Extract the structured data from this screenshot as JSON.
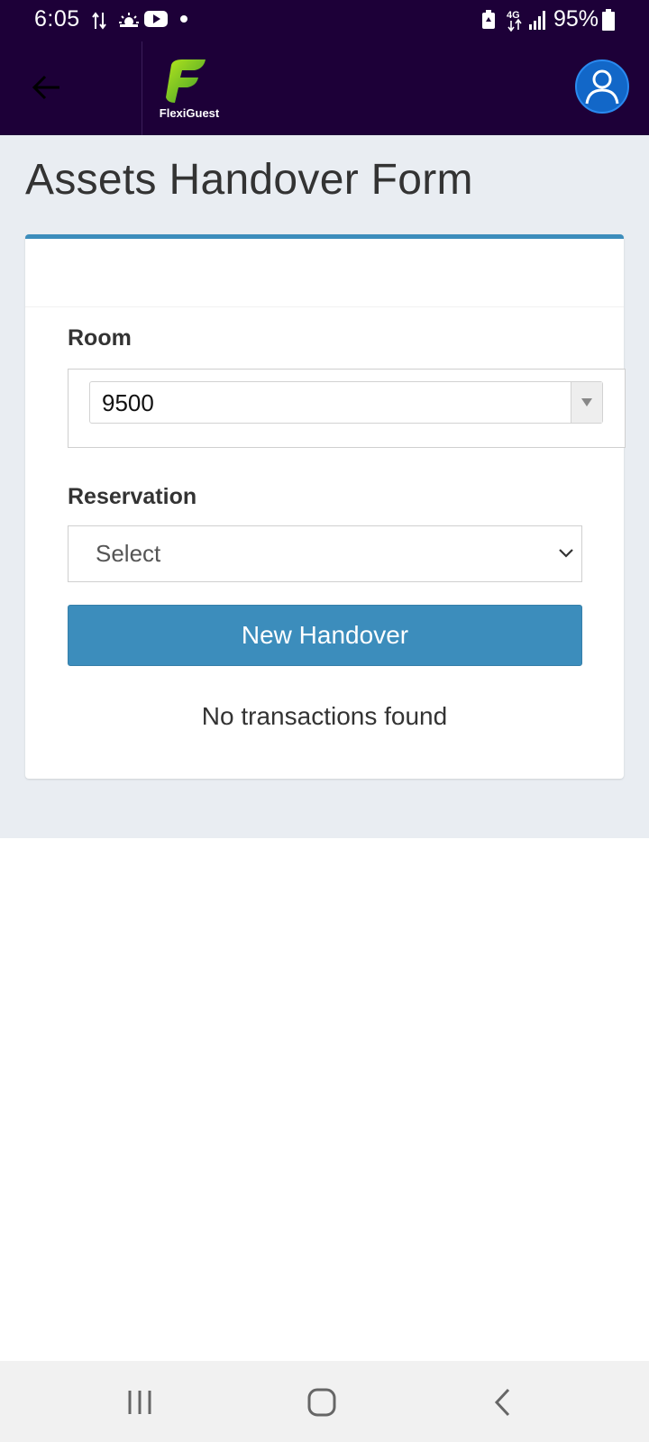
{
  "status_bar": {
    "time": "6:05",
    "battery_percent": "95%",
    "network_type": "4G",
    "icons": [
      "data-transfer-icon",
      "weather-icon",
      "youtube-icon",
      "notification-dot-icon",
      "battery-saver-icon",
      "network-4g-icon",
      "signal-icon",
      "battery-icon"
    ]
  },
  "header": {
    "brand_name": "FlexiGuest",
    "back_icon": "arrow-left-icon",
    "profile_icon": "user-avatar-icon"
  },
  "page": {
    "title": "Assets Handover Form"
  },
  "form": {
    "room_label": "Room",
    "room_value": "9500",
    "reservation_label": "Reservation",
    "reservation_value": "Select",
    "new_handover_label": "New Handover",
    "empty_message": "No transactions found"
  },
  "colors": {
    "header_bg": "#1d0038",
    "accent": "#3c8dbc",
    "page_bg": "#e9edf2",
    "avatar_bg": "#1267c8"
  },
  "nav_bar": {
    "icons": [
      "recent-apps-icon",
      "home-icon",
      "back-nav-icon"
    ]
  }
}
